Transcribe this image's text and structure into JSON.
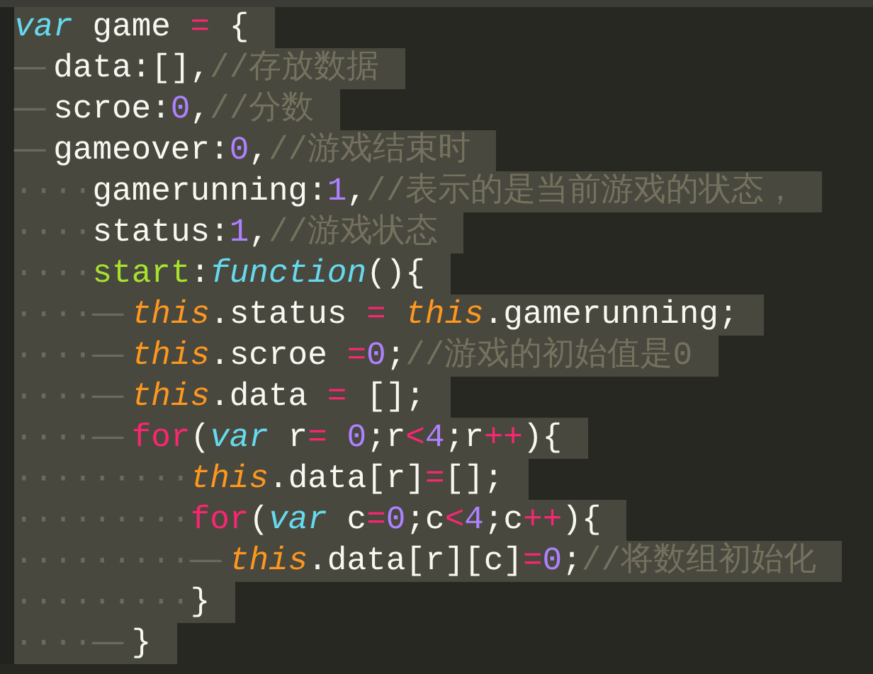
{
  "editor": {
    "lines": [
      {
        "tokens": [
          {
            "kind": "storage",
            "text": "var"
          },
          {
            "kind": "plain",
            "text": " game "
          },
          {
            "kind": "operator",
            "text": "="
          },
          {
            "kind": "plain",
            "text": " {"
          }
        ]
      },
      {
        "indent": "—",
        "tokens": [
          {
            "kind": "plain",
            "text": "data:[],"
          },
          {
            "kind": "comment",
            "text": "//存放数据"
          }
        ]
      },
      {
        "indent": "—",
        "tokens": [
          {
            "kind": "plain",
            "text": "scroe:"
          },
          {
            "kind": "number",
            "text": "0"
          },
          {
            "kind": "plain",
            "text": ","
          },
          {
            "kind": "comment",
            "text": "//分数"
          }
        ]
      },
      {
        "indent": "—",
        "tokens": [
          {
            "kind": "plain",
            "text": "gameover:"
          },
          {
            "kind": "number",
            "text": "0"
          },
          {
            "kind": "plain",
            "text": ","
          },
          {
            "kind": "comment",
            "text": "//游戏结束时"
          }
        ]
      },
      {
        "indent": "····",
        "tokens": [
          {
            "kind": "plain",
            "text": "gamerunning:"
          },
          {
            "kind": "number",
            "text": "1"
          },
          {
            "kind": "plain",
            "text": ","
          },
          {
            "kind": "comment",
            "text": "//表示的是当前游戏的状态，"
          }
        ]
      },
      {
        "indent": "····",
        "tokens": [
          {
            "kind": "plain",
            "text": "status:"
          },
          {
            "kind": "number",
            "text": "1"
          },
          {
            "kind": "plain",
            "text": ","
          },
          {
            "kind": "comment",
            "text": "//游戏状态"
          }
        ]
      },
      {
        "indent": "····",
        "tokens": [
          {
            "kind": "entity",
            "text": "start"
          },
          {
            "kind": "plain",
            "text": ":"
          },
          {
            "kind": "storage",
            "text": "function"
          },
          {
            "kind": "plain",
            "text": "(){"
          }
        ]
      },
      {
        "indent": "····—",
        "tokens": [
          {
            "kind": "this",
            "text": "this"
          },
          {
            "kind": "plain",
            "text": ".status "
          },
          {
            "kind": "operator",
            "text": "= "
          },
          {
            "kind": "this",
            "text": "this"
          },
          {
            "kind": "plain",
            "text": ".gamerunning;"
          }
        ]
      },
      {
        "indent": "····—",
        "tokens": [
          {
            "kind": "this",
            "text": "this"
          },
          {
            "kind": "plain",
            "text": ".scroe "
          },
          {
            "kind": "operator",
            "text": "="
          },
          {
            "kind": "number",
            "text": "0"
          },
          {
            "kind": "plain",
            "text": ";"
          },
          {
            "kind": "comment",
            "text": "//游戏的初始值是0"
          }
        ]
      },
      {
        "indent": "····—",
        "tokens": [
          {
            "kind": "this",
            "text": "this"
          },
          {
            "kind": "plain",
            "text": ".data "
          },
          {
            "kind": "operator",
            "text": "="
          },
          {
            "kind": "plain",
            "text": " [];"
          }
        ]
      },
      {
        "indent": "····—",
        "tokens": [
          {
            "kind": "operator",
            "text": "for"
          },
          {
            "kind": "plain",
            "text": "("
          },
          {
            "kind": "storage",
            "text": "var"
          },
          {
            "kind": "plain",
            "text": " r"
          },
          {
            "kind": "operator",
            "text": "= "
          },
          {
            "kind": "number",
            "text": "0"
          },
          {
            "kind": "plain",
            "text": ";r"
          },
          {
            "kind": "operator",
            "text": "<"
          },
          {
            "kind": "number",
            "text": "4"
          },
          {
            "kind": "plain",
            "text": ";r"
          },
          {
            "kind": "operator",
            "text": "++"
          },
          {
            "kind": "plain",
            "text": "){"
          }
        ]
      },
      {
        "indent": "·········",
        "tokens": [
          {
            "kind": "this",
            "text": "this"
          },
          {
            "kind": "plain",
            "text": ".data[r]"
          },
          {
            "kind": "operator",
            "text": "="
          },
          {
            "kind": "plain",
            "text": "[];"
          }
        ]
      },
      {
        "indent": "·········",
        "tokens": [
          {
            "kind": "operator",
            "text": "for"
          },
          {
            "kind": "plain",
            "text": "("
          },
          {
            "kind": "storage",
            "text": "var"
          },
          {
            "kind": "plain",
            "text": " c"
          },
          {
            "kind": "operator",
            "text": "="
          },
          {
            "kind": "number",
            "text": "0"
          },
          {
            "kind": "plain",
            "text": ";c"
          },
          {
            "kind": "operator",
            "text": "<"
          },
          {
            "kind": "number",
            "text": "4"
          },
          {
            "kind": "plain",
            "text": ";c"
          },
          {
            "kind": "operator",
            "text": "++"
          },
          {
            "kind": "plain",
            "text": "){"
          }
        ]
      },
      {
        "indent": "·········—",
        "tokens": [
          {
            "kind": "this",
            "text": "this"
          },
          {
            "kind": "plain",
            "text": ".data[r][c]"
          },
          {
            "kind": "operator",
            "text": "="
          },
          {
            "kind": "number",
            "text": "0"
          },
          {
            "kind": "plain",
            "text": ";"
          },
          {
            "kind": "comment",
            "text": "//将数组初始化"
          }
        ]
      },
      {
        "indent": "·········",
        "tokens": [
          {
            "kind": "plain",
            "text": "}"
          }
        ]
      },
      {
        "indent": "····—",
        "tokens": [
          {
            "kind": "plain",
            "text": "}"
          }
        ]
      }
    ]
  }
}
